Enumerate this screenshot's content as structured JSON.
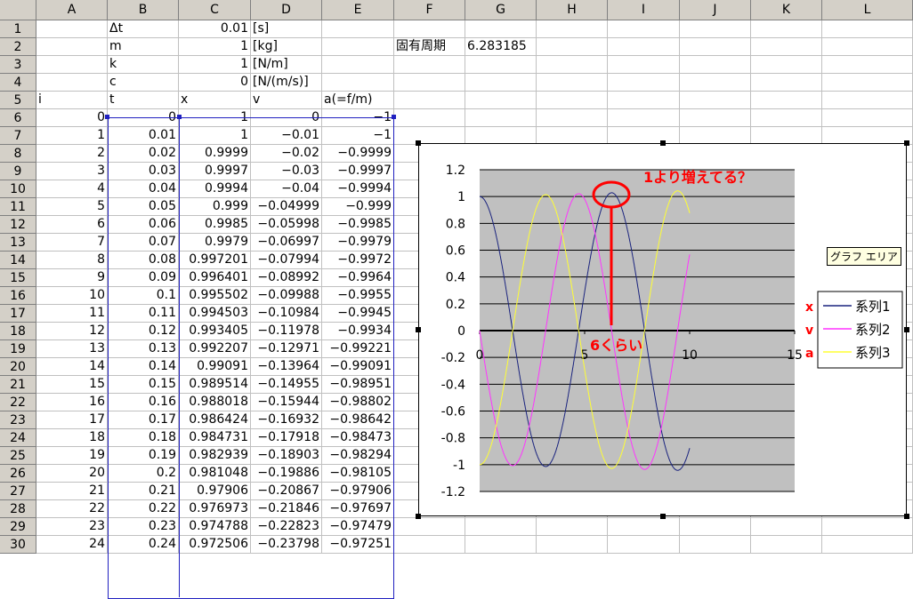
{
  "columns": [
    "A",
    "B",
    "C",
    "D",
    "E",
    "F",
    "G",
    "H",
    "I",
    "J",
    "K",
    "L"
  ],
  "rows": [
    "1",
    "2",
    "3",
    "4",
    "5",
    "6",
    "7",
    "8",
    "9",
    "10",
    "11",
    "12",
    "13",
    "14",
    "15",
    "16",
    "17",
    "18",
    "19",
    "20",
    "21",
    "22",
    "23",
    "24",
    "25",
    "26",
    "27",
    "28",
    "29",
    "30"
  ],
  "params": [
    {
      "label": "Δt",
      "value": "0.01",
      "unit": "[s]"
    },
    {
      "label": "m",
      "value": "1",
      "unit": "[kg]"
    },
    {
      "label": "k",
      "value": "1",
      "unit": "[N/m]"
    },
    {
      "label": "c",
      "value": "0",
      "unit": "[N/(m/s)]"
    }
  ],
  "period_label": "固有周期",
  "period_value": "6.283185",
  "table_headers": {
    "i": "i",
    "t": "t",
    "x": "x",
    "v": "v",
    "a": "a(=f/m)"
  },
  "table_rows": [
    [
      "0",
      "0",
      "1",
      "0",
      "-1"
    ],
    [
      "1",
      "0.01",
      "1",
      "-0.01",
      "-1"
    ],
    [
      "2",
      "0.02",
      "0.9999",
      "-0.02",
      "-0.9999"
    ],
    [
      "3",
      "0.03",
      "0.9997",
      "-0.03",
      "-0.9997"
    ],
    [
      "4",
      "0.04",
      "0.9994",
      "-0.04",
      "-0.9994"
    ],
    [
      "5",
      "0.05",
      "0.999",
      "-0.04999",
      "-0.999"
    ],
    [
      "6",
      "0.06",
      "0.9985",
      "-0.05998",
      "-0.9985"
    ],
    [
      "7",
      "0.07",
      "0.9979",
      "-0.06997",
      "-0.9979"
    ],
    [
      "8",
      "0.08",
      "0.997201",
      "-0.07994",
      "-0.9972"
    ],
    [
      "9",
      "0.09",
      "0.996401",
      "-0.08992",
      "-0.9964"
    ],
    [
      "10",
      "0.1",
      "0.995502",
      "-0.09988",
      "-0.9955"
    ],
    [
      "11",
      "0.11",
      "0.994503",
      "-0.10984",
      "-0.9945"
    ],
    [
      "12",
      "0.12",
      "0.993405",
      "-0.11978",
      "-0.9934"
    ],
    [
      "13",
      "0.13",
      "0.992207",
      "-0.12971",
      "-0.99221"
    ],
    [
      "14",
      "0.14",
      "0.99091",
      "-0.13964",
      "-0.99091"
    ],
    [
      "15",
      "0.15",
      "0.989514",
      "-0.14955",
      "-0.98951"
    ],
    [
      "16",
      "0.16",
      "0.988018",
      "-0.15944",
      "-0.98802"
    ],
    [
      "17",
      "0.17",
      "0.986424",
      "-0.16932",
      "-0.98642"
    ],
    [
      "18",
      "0.18",
      "0.984731",
      "-0.17918",
      "-0.98473"
    ],
    [
      "19",
      "0.19",
      "0.982939",
      "-0.18903",
      "-0.98294"
    ],
    [
      "20",
      "0.2",
      "0.981048",
      "-0.19886",
      "-0.98105"
    ],
    [
      "21",
      "0.21",
      "0.97906",
      "-0.20867",
      "-0.97906"
    ],
    [
      "22",
      "0.22",
      "0.976973",
      "-0.21846",
      "-0.97697"
    ],
    [
      "23",
      "0.23",
      "0.974788",
      "-0.22823",
      "-0.97479"
    ],
    [
      "24",
      "0.24",
      "0.972506",
      "-0.23798",
      "-0.97251"
    ]
  ],
  "tooltip": "グラフ エリア",
  "colors": {
    "x": "#1a237e",
    "v": "#ff33ff",
    "a": "#ffff33",
    "annot": "#ff0000",
    "plot_bg": "#c0c0c0"
  },
  "chart_data": {
    "type": "line",
    "xlim": [
      0,
      15
    ],
    "ylim": [
      -1.2,
      1.2
    ],
    "xticks": [
      "0",
      "5",
      "10",
      "15"
    ],
    "yticks": [
      "1.2",
      "1",
      "0.8",
      "0.6",
      "0.4",
      "0.2",
      "0",
      "-0.2",
      "-0.4",
      "-0.6",
      "-0.8",
      "-1",
      "-1.2"
    ],
    "x_end": 10,
    "dt": 0.01,
    "series": [
      {
        "name": "系列1",
        "annot": "x",
        "formula": "x = cos(t) (slight growth, peak ≈ 1.03 at t ≈ 6.3)"
      },
      {
        "name": "系列2",
        "annot": "v",
        "formula": "v = -sin(t)"
      },
      {
        "name": "系列3",
        "annot": "a",
        "formula": "a = -cos(t)"
      }
    ],
    "annotations": [
      {
        "text": "1より増えてる？"
      },
      {
        "text": "6くらい"
      }
    ]
  }
}
